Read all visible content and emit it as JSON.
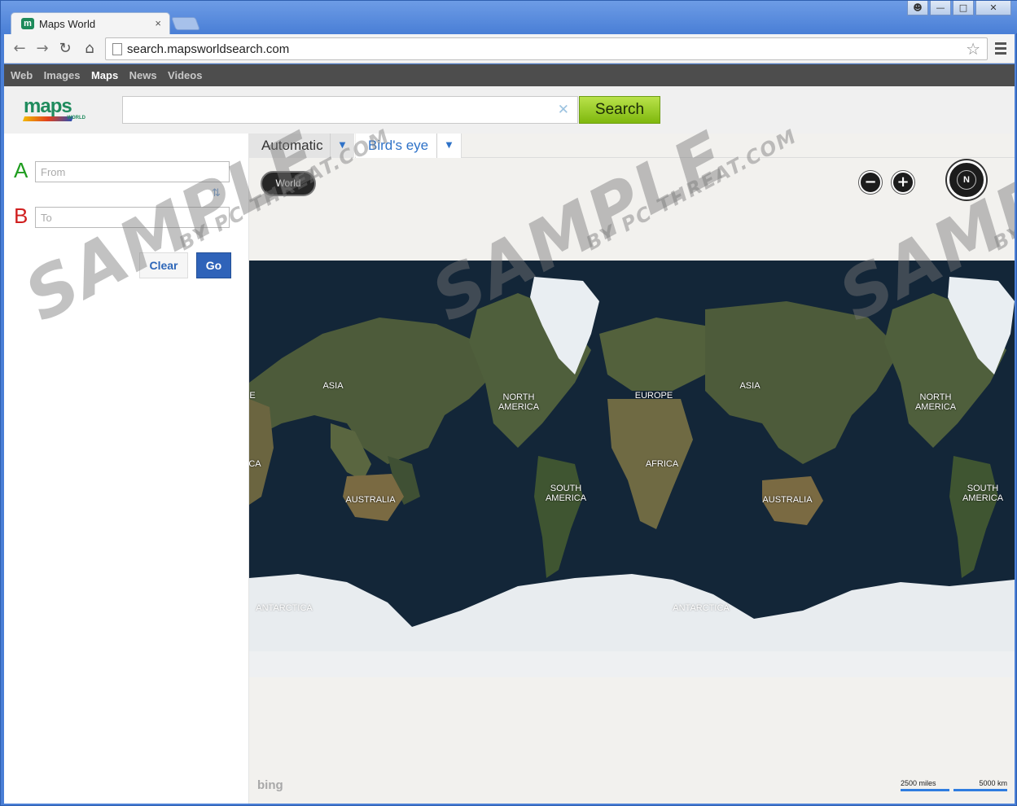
{
  "browser": {
    "tab_title": "Maps World",
    "tab_close": "×",
    "url": "search.mapsworldsearch.com"
  },
  "navbar": {
    "links": [
      {
        "label": "Web",
        "active": false
      },
      {
        "label": "Images",
        "active": false
      },
      {
        "label": "Maps",
        "active": true
      },
      {
        "label": "News",
        "active": false
      },
      {
        "label": "Videos",
        "active": false
      }
    ]
  },
  "header": {
    "logo_text": "maps",
    "logo_sub": "WORLD",
    "search_value": "",
    "search_button": "Search"
  },
  "directions": {
    "point_a": "A",
    "point_b": "B",
    "from_placeholder": "From",
    "to_placeholder": "To",
    "clear_label": "Clear",
    "go_label": "Go"
  },
  "map": {
    "map_types": [
      {
        "label": "Automatic",
        "selected": true
      },
      {
        "label": "Bird's eye",
        "selected": false
      }
    ],
    "breadcrumb": "World",
    "compass_label": "N",
    "continent_labels": [
      {
        "text": "ASIA"
      },
      {
        "text": "NORTH\nAMERICA"
      },
      {
        "text": "SOUTH\nAMERICA"
      },
      {
        "text": "EUROPE"
      },
      {
        "text": "AFRICA"
      },
      {
        "text": "AUSTRALIA"
      },
      {
        "text": "ASIA"
      },
      {
        "text": "NORTH\nAMERICA"
      },
      {
        "text": "SOUTH\nAMERICA"
      },
      {
        "text": "AUSTRALIA"
      },
      {
        "text": "ANTARCTICA"
      },
      {
        "text": "ANTARCTICA"
      },
      {
        "text": "E"
      },
      {
        "text": "CA"
      }
    ],
    "provider": "bing",
    "scale_miles": "2500 miles",
    "scale_km": "5000 km"
  },
  "watermark": {
    "main": "SAMPLE",
    "sub": "BY PC THREAT.COM"
  },
  "colors": {
    "accent": "#2f63b9",
    "search_button": "#8fc41a",
    "ocean": "#132638",
    "land": "#4e5e3a",
    "ice": "#e8ecef"
  }
}
